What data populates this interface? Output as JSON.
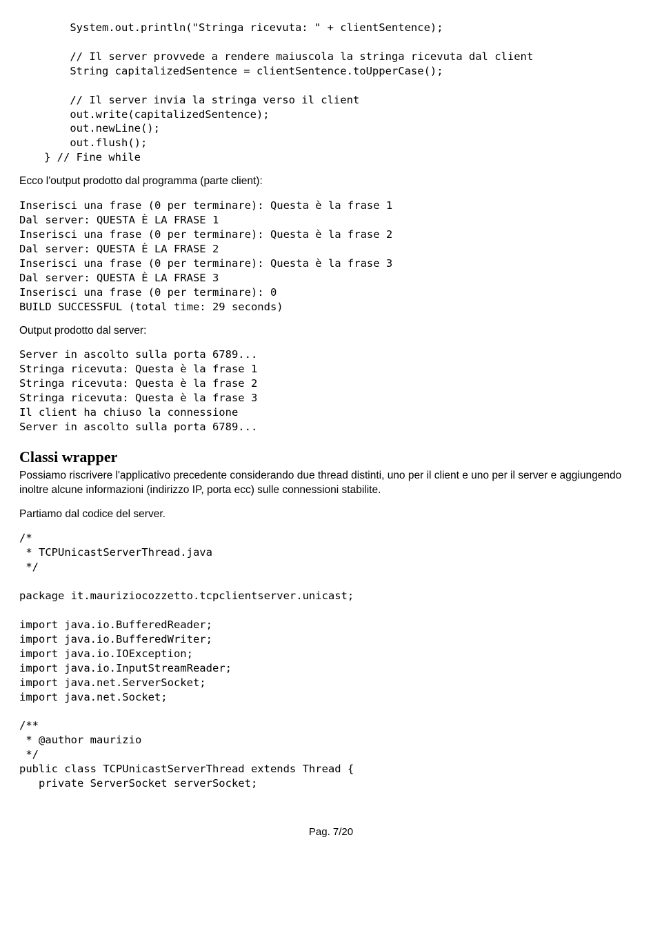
{
  "codeblock1": "    System.out.println(\"Stringa ricevuta: \" + clientSentence);\n\n    // Il server provvede a rendere maiuscola la stringa ricevuta dal client\n    String capitalizedSentence = clientSentence.toUpperCase();\n\n    // Il server invia la stringa verso il client\n    out.write(capitalizedSentence);\n    out.newLine();\n    out.flush();\n} // Fine while",
  "prose1": "Ecco l'output prodotto dal programma (parte client):",
  "output_client": "Inserisci una frase (0 per terminare): Questa è la frase 1\nDal server: QUESTA È LA FRASE 1\nInserisci una frase (0 per terminare): Questa è la frase 2\nDal server: QUESTA È LA FRASE 2\nInserisci una frase (0 per terminare): Questa è la frase 3\nDal server: QUESTA È LA FRASE 3\nInserisci una frase (0 per terminare): 0\nBUILD SUCCESSFUL (total time: 29 seconds)",
  "prose2": "Output prodotto dal server:",
  "output_server": "Server in ascolto sulla porta 6789...\nStringa ricevuta: Questa è la frase 1\nStringa ricevuta: Questa è la frase 2\nStringa ricevuta: Questa è la frase 3\nIl client ha chiuso la connessione\nServer in ascolto sulla porta 6789...",
  "heading1": "Classi wrapper",
  "prose3": "Possiamo riscrivere l'applicativo precedente considerando due thread distinti, uno per il client e uno per il server e aggiungendo inoltre alcune informazioni (indirizzo IP, porta ecc) sulle connessioni stabilite.",
  "prose4": "Partiamo dal codice del server.",
  "codeblock2": "/*\n * TCPUnicastServerThread.java\n */\n\npackage it.mauriziocozzetto.tcpclientserver.unicast;\n\nimport java.io.BufferedReader;\nimport java.io.BufferedWriter;\nimport java.io.IOException;\nimport java.io.InputStreamReader;\nimport java.net.ServerSocket;\nimport java.net.Socket;\n\n/**\n * @author maurizio\n */\npublic class TCPUnicastServerThread extends Thread {\n   private ServerSocket serverSocket;",
  "pager": "Pag. 7/20"
}
